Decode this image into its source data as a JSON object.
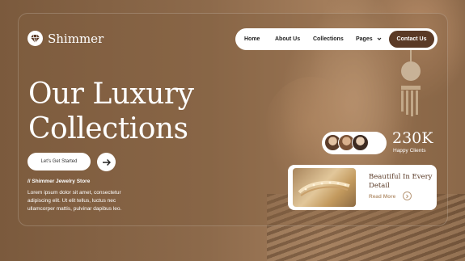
{
  "brand": {
    "name": "Shimmer",
    "logo_icon": "gem-heart-icon"
  },
  "nav": {
    "items": [
      {
        "label": "Home"
      },
      {
        "label": "About Us"
      },
      {
        "label": "Collections"
      },
      {
        "label": "Pages",
        "icon": "chevron-down-icon"
      }
    ],
    "cta_label": "Contact Us"
  },
  "hero": {
    "title_line1": "Our Luxury",
    "title_line2": "Collections",
    "cta_label": "Let's Get Started",
    "arrow_icon": "arrow-right-icon",
    "store_label": "// Shimmer Jewelry Store",
    "description": "Lorem ipsum dolor sit amet, consectetur adipiscing elit. Ut elit tellus, luctus nec ullamcorper mattis, pulvinar dapibus leo."
  },
  "clients": {
    "count": "230K",
    "label": "Happy Clients",
    "add_icon": "plus-icon"
  },
  "card": {
    "title": "Beautiful In Every Detail",
    "link_label": "Read More",
    "link_icon": "chevron-right-icon"
  },
  "colors": {
    "accent": "#5a3a26",
    "panel": "#8a6a4b",
    "card_title": "#5a3a26",
    "muted": "#b89878"
  }
}
